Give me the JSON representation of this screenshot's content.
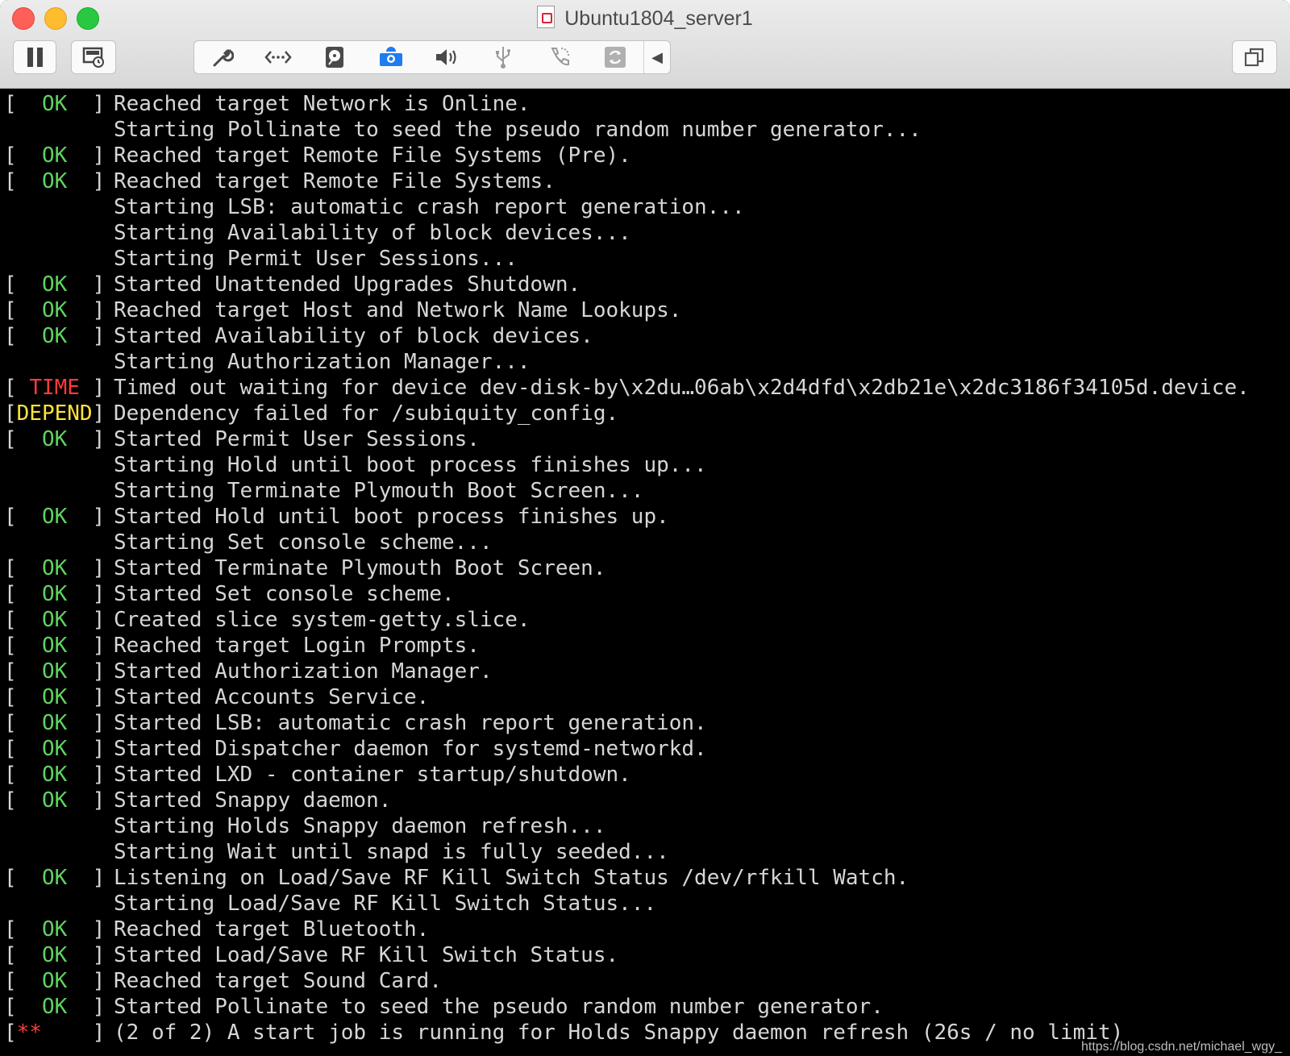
{
  "window": {
    "title": "Ubuntu1804_server1",
    "doc_icon": "vm-document-icon"
  },
  "toolbar": {
    "pause_icon": "pause-icon",
    "snapshot_icon": "snapshot-icon",
    "group_icons": [
      "wrench-icon",
      "network-icon",
      "disk-icon",
      "camera-icon",
      "speaker-icon",
      "usb-icon",
      "phone-icon",
      "refresh-icon",
      "chevron-left-icon"
    ],
    "restore_icon": "restore-window-icon"
  },
  "console": {
    "lines": [
      {
        "status": "OK",
        "kind": "ok",
        "text": "Reached target Network is Online."
      },
      {
        "status": "",
        "kind": "none",
        "text": "Starting Pollinate to seed the pseudo random number generator..."
      },
      {
        "status": "OK",
        "kind": "ok",
        "text": "Reached target Remote File Systems (Pre)."
      },
      {
        "status": "OK",
        "kind": "ok",
        "text": "Reached target Remote File Systems."
      },
      {
        "status": "",
        "kind": "none",
        "text": "Starting LSB: automatic crash report generation..."
      },
      {
        "status": "",
        "kind": "none",
        "text": "Starting Availability of block devices..."
      },
      {
        "status": "",
        "kind": "none",
        "text": "Starting Permit User Sessions..."
      },
      {
        "status": "OK",
        "kind": "ok",
        "text": "Started Unattended Upgrades Shutdown."
      },
      {
        "status": "OK",
        "kind": "ok",
        "text": "Reached target Host and Network Name Lookups."
      },
      {
        "status": "OK",
        "kind": "ok",
        "text": "Started Availability of block devices."
      },
      {
        "status": "",
        "kind": "none",
        "text": "Starting Authorization Manager..."
      },
      {
        "status": "TIME",
        "kind": "time",
        "text": "Timed out waiting for device dev-disk-by\\x2du…06ab\\x2d4dfd\\x2db21e\\x2dc3186f34105d.device."
      },
      {
        "status": "DEPEND",
        "kind": "depend",
        "text": "Dependency failed for /subiquity_config."
      },
      {
        "status": "OK",
        "kind": "ok",
        "text": "Started Permit User Sessions."
      },
      {
        "status": "",
        "kind": "none",
        "text": "Starting Hold until boot process finishes up..."
      },
      {
        "status": "",
        "kind": "none",
        "text": "Starting Terminate Plymouth Boot Screen..."
      },
      {
        "status": "OK",
        "kind": "ok",
        "text": "Started Hold until boot process finishes up."
      },
      {
        "status": "",
        "kind": "none",
        "text": "Starting Set console scheme..."
      },
      {
        "status": "OK",
        "kind": "ok",
        "text": "Started Terminate Plymouth Boot Screen."
      },
      {
        "status": "OK",
        "kind": "ok",
        "text": "Started Set console scheme."
      },
      {
        "status": "OK",
        "kind": "ok",
        "text": "Created slice system-getty.slice."
      },
      {
        "status": "OK",
        "kind": "ok",
        "text": "Reached target Login Prompts."
      },
      {
        "status": "OK",
        "kind": "ok",
        "text": "Started Authorization Manager."
      },
      {
        "status": "OK",
        "kind": "ok",
        "text": "Started Accounts Service."
      },
      {
        "status": "OK",
        "kind": "ok",
        "text": "Started LSB: automatic crash report generation."
      },
      {
        "status": "OK",
        "kind": "ok",
        "text": "Started Dispatcher daemon for systemd-networkd."
      },
      {
        "status": "OK",
        "kind": "ok",
        "text": "Started LXD - container startup/shutdown."
      },
      {
        "status": "OK",
        "kind": "ok",
        "text": "Started Snappy daemon."
      },
      {
        "status": "",
        "kind": "none",
        "text": "Starting Holds Snappy daemon refresh..."
      },
      {
        "status": "",
        "kind": "none",
        "text": "Starting Wait until snapd is fully seeded..."
      },
      {
        "status": "OK",
        "kind": "ok",
        "text": "Listening on Load/Save RF Kill Switch Status /dev/rfkill Watch."
      },
      {
        "status": "",
        "kind": "none",
        "text": "Starting Load/Save RF Kill Switch Status..."
      },
      {
        "status": "OK",
        "kind": "ok",
        "text": "Reached target Bluetooth."
      },
      {
        "status": "OK",
        "kind": "ok",
        "text": "Started Load/Save RF Kill Switch Status."
      },
      {
        "status": "OK",
        "kind": "ok",
        "text": "Reached target Sound Card."
      },
      {
        "status": "OK",
        "kind": "ok",
        "text": "Started Pollinate to seed the pseudo random number generator."
      },
      {
        "status": "**",
        "kind": "star",
        "text": "(2 of 2) A start job is running for Holds Snappy daemon refresh (26s / no limit)"
      }
    ]
  },
  "watermark": "https://blog.csdn.net/michael_wgy_",
  "colors": {
    "ok": "#5fd35f",
    "time": "#ff3c3c",
    "depend": "#ffe43a",
    "star": "#ff3c3c",
    "text": "#d6d6d6",
    "active_icon": "#1f7cf2"
  }
}
